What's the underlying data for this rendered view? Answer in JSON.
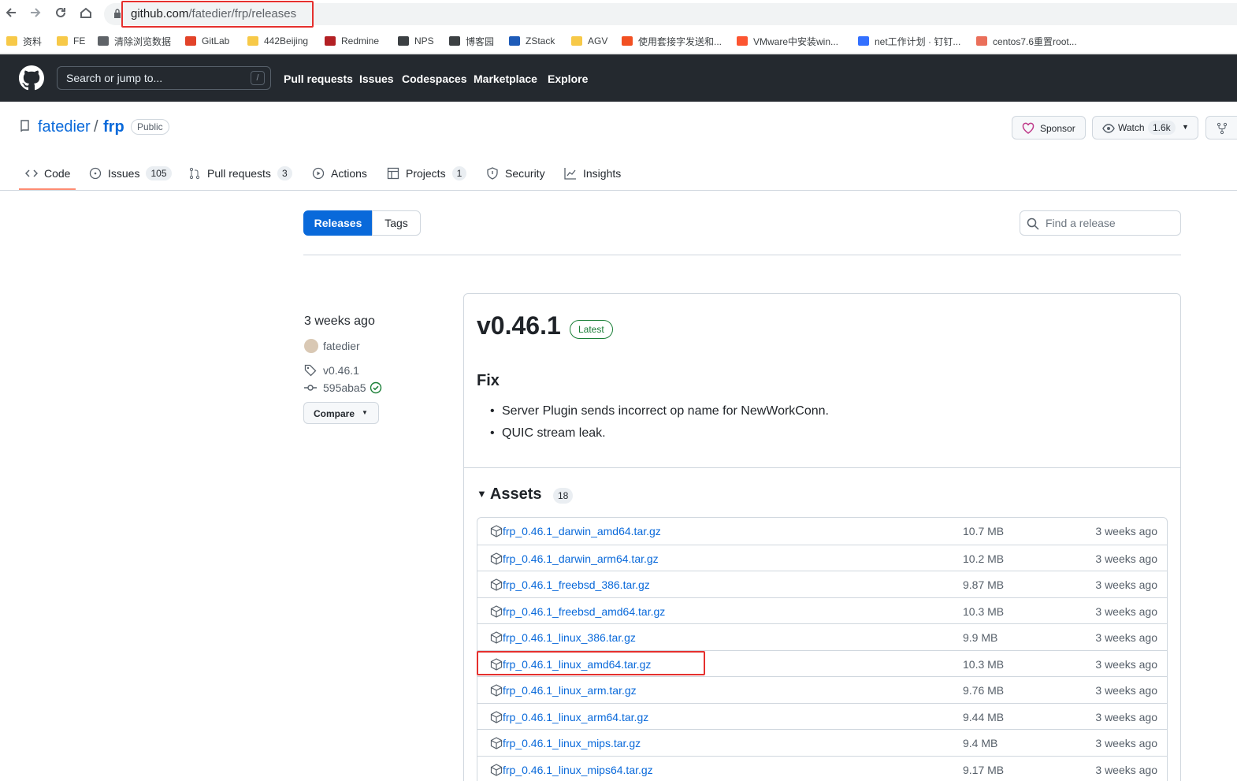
{
  "browser": {
    "url_host": "github.com",
    "url_path": "/fatedier/frp/releases",
    "bookmarks": [
      {
        "label": "资料",
        "color": "#f7c948",
        "icon": "folder-icon"
      },
      {
        "label": "FE",
        "color": "#f7c948",
        "icon": "folder-icon"
      },
      {
        "label": "清除浏览数据",
        "color": "#5f6368",
        "icon": "gear-icon"
      },
      {
        "label": "GitLab",
        "color": "#e24329",
        "icon": "gitlab-icon"
      },
      {
        "label": "442Beijing",
        "color": "#f7c948",
        "icon": "folder-icon"
      },
      {
        "label": "Redmine",
        "color": "#b32024",
        "icon": "redmine-icon"
      },
      {
        "label": "NPS",
        "color": "#3c4043",
        "icon": "globe-icon"
      },
      {
        "label": "博客园",
        "color": "#3c4043",
        "icon": "cnblogs-icon"
      },
      {
        "label": "ZStack",
        "color": "#1e5bb8",
        "icon": "zstack-icon"
      },
      {
        "label": "AGV",
        "color": "#f7c948",
        "icon": "folder-icon"
      },
      {
        "label": "使用套接字发送和...",
        "color": "#f25022",
        "icon": "microsoft-icon"
      },
      {
        "label": "VMware中安装win...",
        "color": "#fc5531",
        "icon": "csdn-icon"
      },
      {
        "label": "net工作计划 · 钉钉...",
        "color": "#3370ff",
        "icon": "dingtalk-icon"
      },
      {
        "label": "centos7.6重置root...",
        "color": "#ea6f5a",
        "icon": "jianshu-icon"
      }
    ]
  },
  "gh_header": {
    "search_placeholder": "Search or jump to...",
    "search_shortcut": "/",
    "nav": [
      "Pull requests",
      "Issues",
      "Codespaces",
      "Marketplace",
      "Explore"
    ]
  },
  "repo": {
    "owner": "fatedier",
    "separator": "/",
    "name": "frp",
    "visibility": "Public",
    "sponsor_label": "Sponsor",
    "watch_label": "Watch",
    "watch_count": "1.6k"
  },
  "tabs": [
    {
      "label": "Code",
      "count": "",
      "icon": "code-icon"
    },
    {
      "label": "Issues",
      "count": "105",
      "icon": "issue-icon"
    },
    {
      "label": "Pull requests",
      "count": "3",
      "icon": "pull-request-icon"
    },
    {
      "label": "Actions",
      "count": "",
      "icon": "play-icon"
    },
    {
      "label": "Projects",
      "count": "1",
      "icon": "table-icon"
    },
    {
      "label": "Security",
      "count": "",
      "icon": "shield-icon"
    },
    {
      "label": "Insights",
      "count": "",
      "icon": "graph-icon"
    }
  ],
  "toolbar": {
    "releases_label": "Releases",
    "tags_label": "Tags",
    "find_placeholder": "Find a release"
  },
  "release": {
    "date": "3 weeks ago",
    "author": "fatedier",
    "tag": "v0.46.1",
    "commit": "595aba5",
    "compare_label": "Compare",
    "version": "v0.46.1",
    "latest_label": "Latest",
    "section_title": "Fix",
    "notes": [
      "Server Plugin sends incorrect op name for NewWorkConn.",
      "QUIC stream leak."
    ],
    "assets_title": "Assets",
    "assets_count": "18",
    "assets": [
      {
        "name": "frp_0.46.1_darwin_amd64.tar.gz",
        "size": "10.7 MB",
        "time": "3 weeks ago"
      },
      {
        "name": "frp_0.46.1_darwin_arm64.tar.gz",
        "size": "10.2 MB",
        "time": "3 weeks ago"
      },
      {
        "name": "frp_0.46.1_freebsd_386.tar.gz",
        "size": "9.87 MB",
        "time": "3 weeks ago"
      },
      {
        "name": "frp_0.46.1_freebsd_amd64.tar.gz",
        "size": "10.3 MB",
        "time": "3 weeks ago"
      },
      {
        "name": "frp_0.46.1_linux_386.tar.gz",
        "size": "9.9 MB",
        "time": "3 weeks ago"
      },
      {
        "name": "frp_0.46.1_linux_amd64.tar.gz",
        "size": "10.3 MB",
        "time": "3 weeks ago"
      },
      {
        "name": "frp_0.46.1_linux_arm.tar.gz",
        "size": "9.76 MB",
        "time": "3 weeks ago"
      },
      {
        "name": "frp_0.46.1_linux_arm64.tar.gz",
        "size": "9.44 MB",
        "time": "3 weeks ago"
      },
      {
        "name": "frp_0.46.1_linux_mips.tar.gz",
        "size": "9.4 MB",
        "time": "3 weeks ago"
      },
      {
        "name": "frp_0.46.1_linux_mips64.tar.gz",
        "size": "9.17 MB",
        "time": "3 weeks ago"
      }
    ]
  },
  "colors": {
    "link": "#0969da",
    "header_bg": "#24292f",
    "primary_button": "#0969da",
    "latest_badge": "#1a7f37",
    "annotation_red": "#e5302e"
  }
}
